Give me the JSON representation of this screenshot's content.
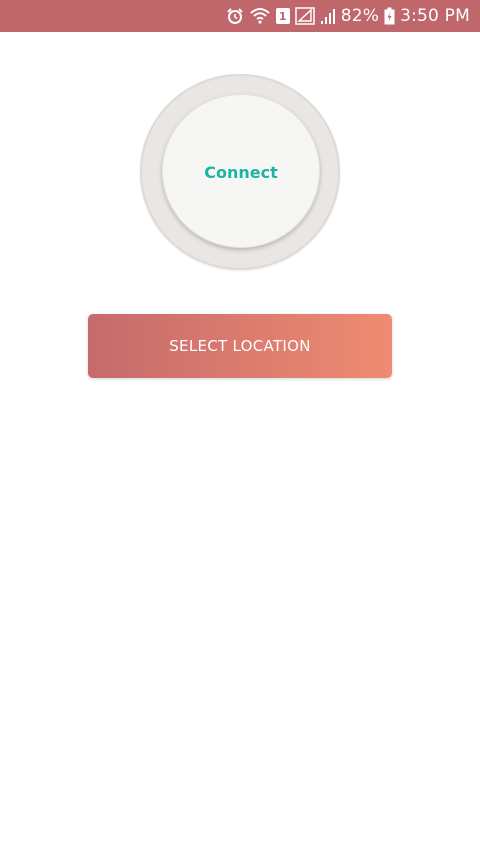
{
  "status_bar": {
    "battery_percent": "82%",
    "time": "3:50 PM",
    "sim_label": "1",
    "icons": [
      "alarm-icon",
      "wifi-icon",
      "sim-icon",
      "signal-lte-icon",
      "signal-icon",
      "battery-charging-icon"
    ],
    "background_color": "#c0676c"
  },
  "main": {
    "connect_label": "Connect",
    "connect_label_color": "#1ab5a2",
    "select_location_label": "SELECT LOCATION",
    "select_location_gradient": [
      "#c66b6c",
      "#ee8b71"
    ]
  }
}
